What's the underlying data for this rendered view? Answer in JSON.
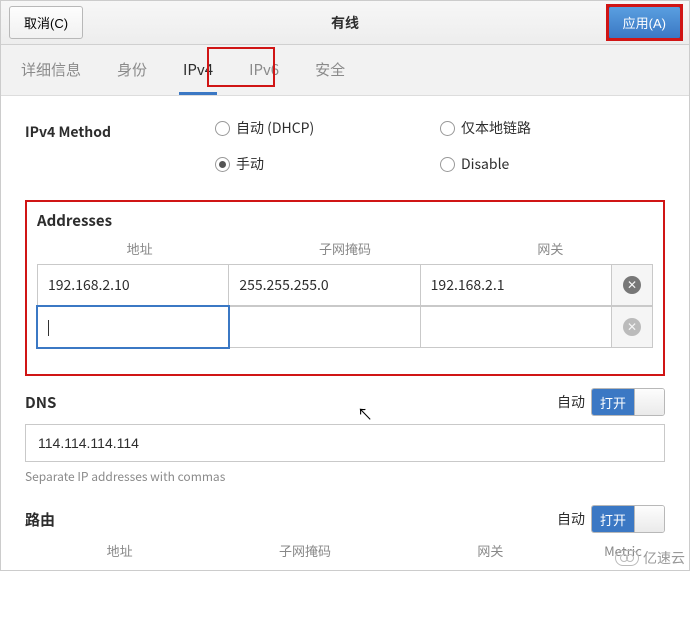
{
  "titlebar": {
    "cancel": "取消(C)",
    "title": "有线",
    "apply": "应用(A)"
  },
  "tabs": {
    "details": "详细信息",
    "identity": "身份",
    "ipv4": "IPv4",
    "ipv6": "IPv6",
    "security": "安全"
  },
  "method": {
    "label": "IPv4 Method",
    "auto": "自动 (DHCP)",
    "link_local": "仅本地链路",
    "manual": "手动",
    "disable": "Disable"
  },
  "addresses": {
    "title": "Addresses",
    "col_address": "地址",
    "col_netmask": "子网掩码",
    "col_gateway": "网关",
    "rows": [
      {
        "address": "192.168.2.10",
        "netmask": "255.255.255.0",
        "gateway": "192.168.2.1"
      },
      {
        "address": "",
        "netmask": "",
        "gateway": ""
      }
    ]
  },
  "dns": {
    "title": "DNS",
    "auto_label": "自动",
    "toggle_on": "打开",
    "value": "114.114.114.114",
    "hint": "Separate IP addresses with commas"
  },
  "routes": {
    "title": "路由",
    "auto_label": "自动",
    "toggle_on": "打开",
    "col_address": "地址",
    "col_netmask": "子网掩码",
    "col_gateway": "网关",
    "col_metric": "Metric"
  },
  "watermark": "亿速云"
}
